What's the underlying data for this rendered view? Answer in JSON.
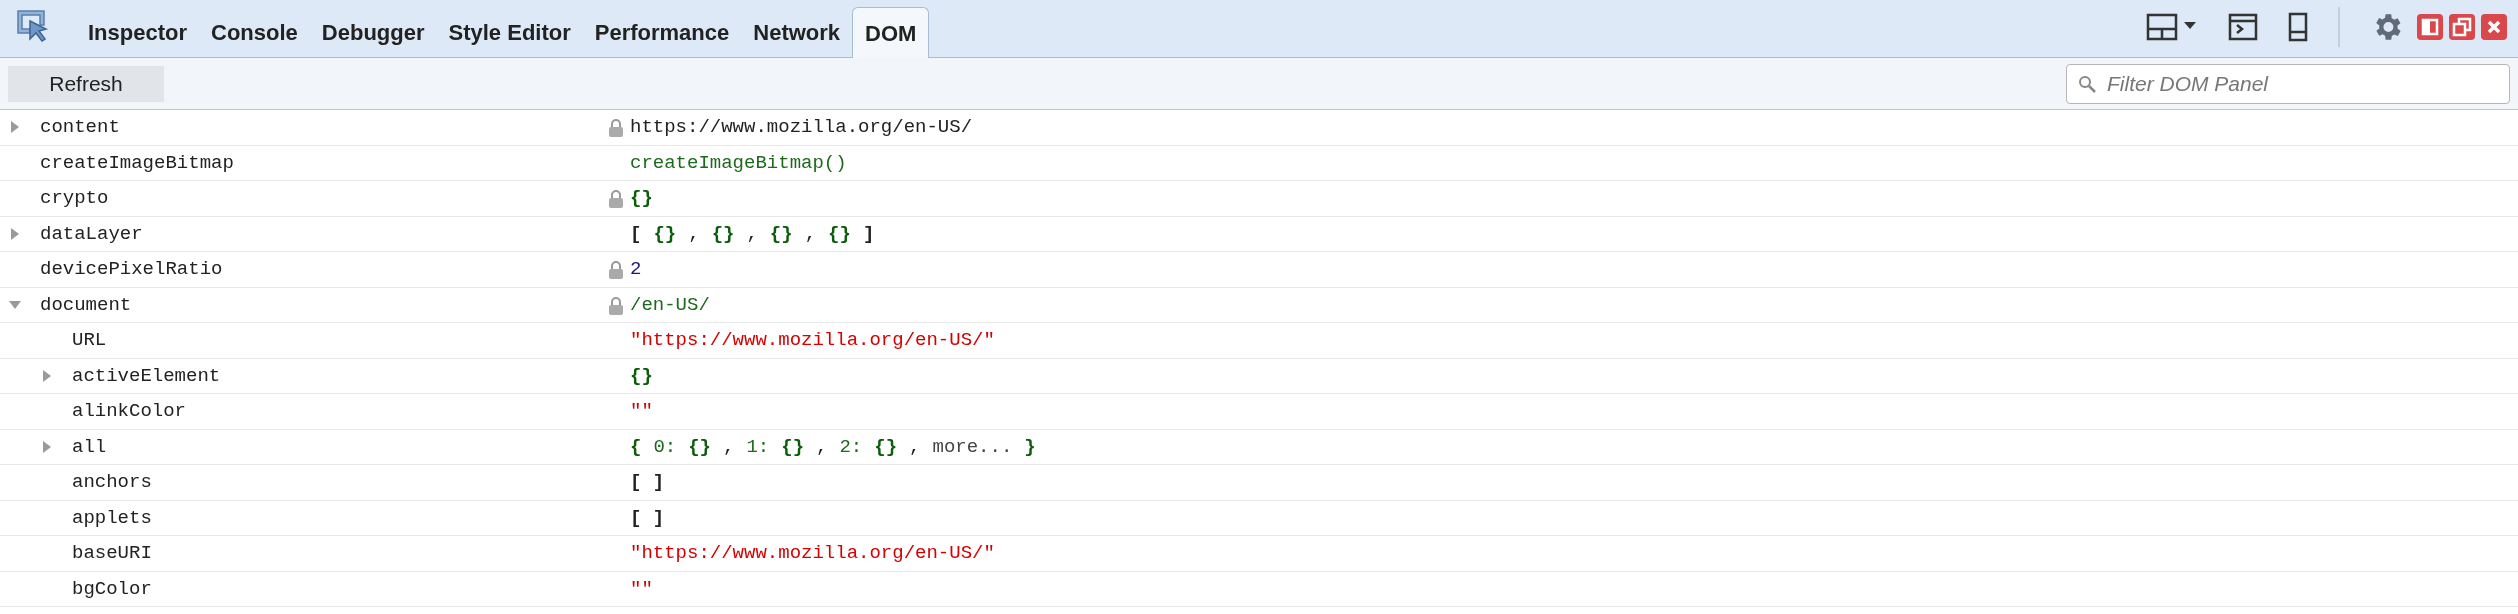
{
  "tabs": [
    {
      "label": "Inspector",
      "selected": false
    },
    {
      "label": "Console",
      "selected": false
    },
    {
      "label": "Debugger",
      "selected": false
    },
    {
      "label": "Style Editor",
      "selected": false
    },
    {
      "label": "Performance",
      "selected": false
    },
    {
      "label": "Network",
      "selected": false
    },
    {
      "label": "DOM",
      "selected": true
    }
  ],
  "toolbar": {
    "refresh": "Refresh",
    "filter": {
      "placeholder": "Filter DOM Panel"
    }
  },
  "rows": [
    {
      "name": "content",
      "expanded": false,
      "locked": true,
      "value": [
        {
          "kind": "plain",
          "text": "https://www.mozilla.org/en-US/"
        }
      ]
    },
    {
      "name": "createImageBitmap",
      "locked": false,
      "value": [
        {
          "kind": "function",
          "text": "createImageBitmap()"
        }
      ]
    },
    {
      "name": "crypto",
      "locked": true,
      "value": [
        {
          "kind": "object",
          "text": "{}"
        }
      ]
    },
    {
      "name": "dataLayer",
      "expanded": false,
      "locked": false,
      "value": [
        {
          "kind": "bracket",
          "text": "["
        },
        {
          "kind": "object",
          "text": "{}"
        },
        {
          "kind": "plain",
          "text": ","
        },
        {
          "kind": "object",
          "text": "{}"
        },
        {
          "kind": "plain",
          "text": ","
        },
        {
          "kind": "object",
          "text": "{}"
        },
        {
          "kind": "plain",
          "text": ","
        },
        {
          "kind": "object",
          "text": "{}"
        },
        {
          "kind": "bracket",
          "text": "]"
        }
      ]
    },
    {
      "name": "devicePixelRatio",
      "locked": true,
      "value": [
        {
          "kind": "number",
          "text": "2"
        }
      ]
    },
    {
      "name": "document",
      "expanded": true,
      "locked": true,
      "value": [
        {
          "kind": "function",
          "text": "/en-US/"
        }
      ],
      "children": [
        {
          "name": "URL",
          "locked": false,
          "value": [
            {
              "kind": "string",
              "text": "\"https://www.mozilla.org/en-US/\""
            }
          ]
        },
        {
          "name": "activeElement",
          "expanded": false,
          "locked": false,
          "value": [
            {
              "kind": "object",
              "text": "{}"
            }
          ]
        },
        {
          "name": "alinkColor",
          "locked": false,
          "value": [
            {
              "kind": "string",
              "text": "\"\""
            }
          ]
        },
        {
          "name": "all",
          "expanded": false,
          "locked": false,
          "value": [
            {
              "kind": "object",
              "text": "{"
            },
            {
              "kind": "function",
              "text": "0:"
            },
            {
              "kind": "object",
              "text": "{}"
            },
            {
              "kind": "plain",
              "text": ","
            },
            {
              "kind": "function",
              "text": "1:"
            },
            {
              "kind": "object",
              "text": "{}"
            },
            {
              "kind": "plain",
              "text": ","
            },
            {
              "kind": "function",
              "text": "2:"
            },
            {
              "kind": "object",
              "text": "{}"
            },
            {
              "kind": "plain",
              "text": ","
            },
            {
              "kind": "more",
              "text": "more..."
            },
            {
              "kind": "object",
              "text": "}"
            }
          ]
        },
        {
          "name": "anchors",
          "locked": false,
          "value": [
            {
              "kind": "bracket",
              "text": "[ ]"
            }
          ]
        },
        {
          "name": "applets",
          "locked": false,
          "value": [
            {
              "kind": "bracket",
              "text": "[ ]"
            }
          ]
        },
        {
          "name": "baseURI",
          "locked": false,
          "value": [
            {
              "kind": "string",
              "text": "\"https://www.mozilla.org/en-US/\""
            }
          ]
        },
        {
          "name": "bgColor",
          "locked": false,
          "value": [
            {
              "kind": "string",
              "text": "\"\""
            }
          ]
        }
      ]
    }
  ]
}
